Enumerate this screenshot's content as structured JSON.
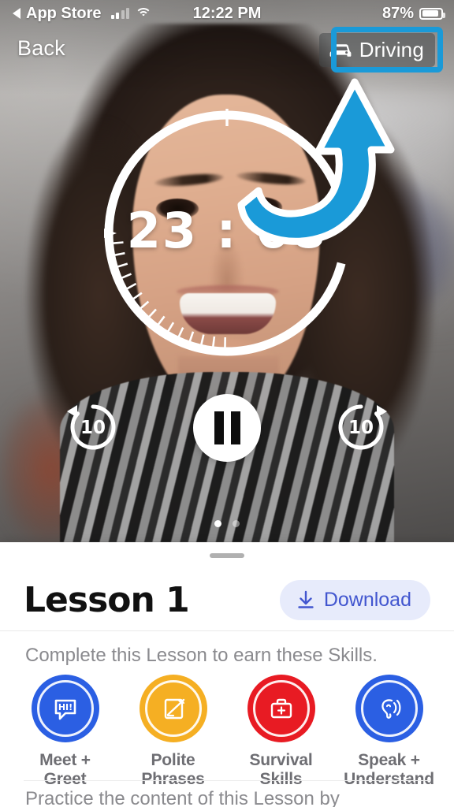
{
  "status_bar": {
    "carrier_back_label": "App Store",
    "back_arrow_icon": "left-triangle-icon",
    "signal_icon": "cellular-signal-icon",
    "wifi_icon": "wifi-icon",
    "time": "12:22 PM",
    "battery_percent": "87%",
    "battery_icon": "battery-icon"
  },
  "nav": {
    "back_label": "Back",
    "driving_label": "Driving",
    "driving_icon": "car-icon",
    "highlight_color": "#1A9AD8"
  },
  "player": {
    "timer": "23 : 08",
    "timer_minutes": "23",
    "timer_separator": ":",
    "timer_seconds": "08",
    "rewind_label": "10",
    "rewind_icon": "rewind-10-icon",
    "forward_label": "10",
    "forward_icon": "forward-10-icon",
    "play_pause_icon": "pause-icon",
    "page_dots": [
      {
        "active": true
      },
      {
        "active": false
      }
    ]
  },
  "annotation": {
    "arrow_icon": "curved-arrow-icon",
    "arrow_color": "#1A9AD8",
    "points_to": "driving-button"
  },
  "sheet": {
    "drag_handle_icon": "drag-handle-icon",
    "lesson_title": "Lesson 1",
    "download_label": "Download",
    "download_icon": "download-icon",
    "download_bg": "#E7EBFB",
    "download_fg": "#4256CF",
    "skills_caption": "Complete this Lesson to earn these Skills.",
    "skills": [
      {
        "label": "Meet +\nGreet",
        "line1": "Meet +",
        "line2": "Greet",
        "color": "#2B5FE3",
        "icon": "speech-bubble-hi-icon",
        "icon_text": "HI!"
      },
      {
        "label": "Polite\nPhrases",
        "line1": "Polite",
        "line2": "Phrases",
        "color": "#F5AF23",
        "icon": "quill-letter-icon",
        "icon_text": ""
      },
      {
        "label": "Survival\nSkills",
        "line1": "Survival",
        "line2": "Skills",
        "color": "#E81B23",
        "icon": "first-aid-kit-icon",
        "icon_text": ""
      },
      {
        "label": "Speak +\nUnderstand",
        "line1": "Speak +",
        "line2": "Understand",
        "color": "#2B5FE3",
        "icon": "ear-listening-icon",
        "icon_text": ""
      }
    ],
    "practice_text": "Practice the content of this Lesson by"
  }
}
